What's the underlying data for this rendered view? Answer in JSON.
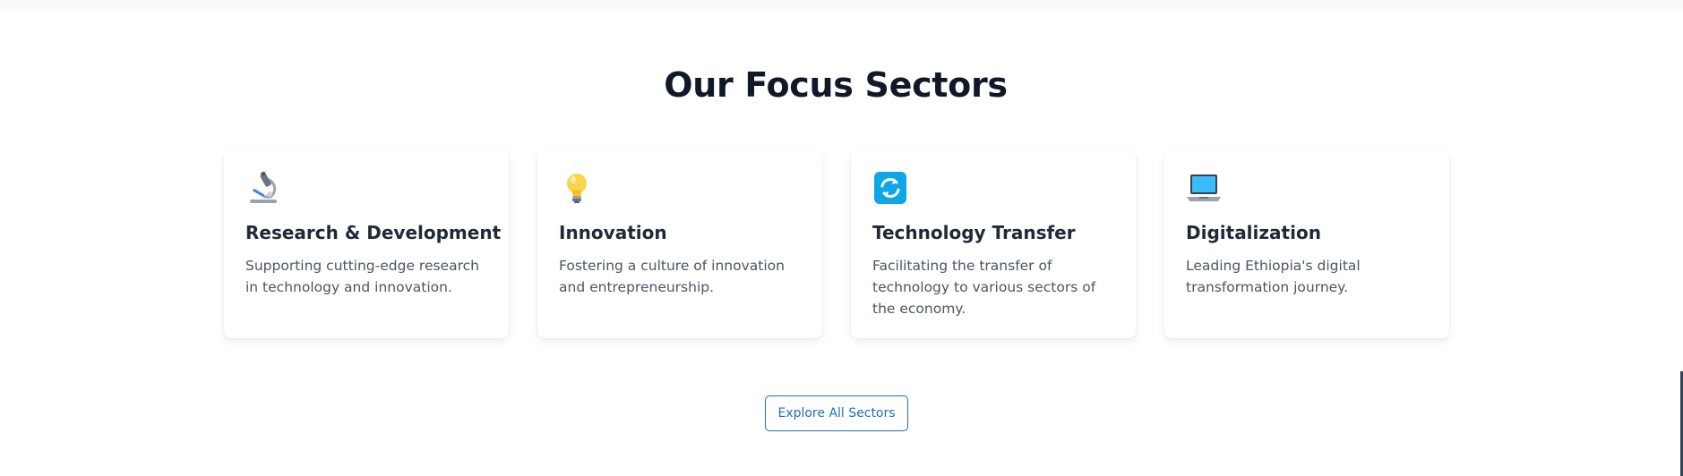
{
  "section": {
    "title": "Our Focus Sectors",
    "cards": [
      {
        "icon": "microscope-icon",
        "title": "Research & Development",
        "description": "Supporting cutting-edge research in technology and innovation."
      },
      {
        "icon": "light-bulb-icon",
        "title": "Innovation",
        "description": "Fostering a culture of innovation and entrepreneurship."
      },
      {
        "icon": "refresh-arrows-icon",
        "title": "Technology Transfer",
        "description": "Facilitating the transfer of technology to various sectors of the economy."
      },
      {
        "icon": "laptop-icon",
        "title": "Digitalization",
        "description": "Leading Ethiopia's digital transformation journey."
      }
    ],
    "explore_label": "Explore All Sectors"
  },
  "colors": {
    "heading": "#111827",
    "body_text": "#4b5563",
    "accent": "#1d6fb8",
    "refresh_icon_bg": "#0ea5e9"
  }
}
